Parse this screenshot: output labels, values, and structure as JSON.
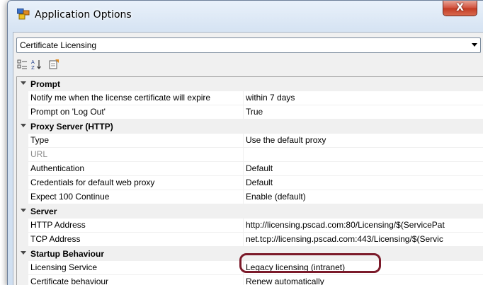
{
  "window": {
    "title": "Application Options",
    "close_label": "X"
  },
  "category": {
    "selected": "Certificate Licensing"
  },
  "toolbar": {
    "icons": [
      "categorized-icon",
      "sort-alphabetical-icon",
      "property-pages-icon"
    ]
  },
  "grid": {
    "rows": [
      {
        "type": "category",
        "label": "Prompt"
      },
      {
        "type": "property",
        "name": "Notify me when the license certificate will expire",
        "value": "within 7 days"
      },
      {
        "type": "property",
        "name": "Prompt on 'Log Out'",
        "value": "True"
      },
      {
        "type": "category",
        "label": "Proxy Server (HTTP)"
      },
      {
        "type": "property",
        "name": "Type",
        "value": "Use the default proxy"
      },
      {
        "type": "property",
        "name": "URL",
        "value": "",
        "disabled": true
      },
      {
        "type": "property",
        "name": "Authentication",
        "value": "Default"
      },
      {
        "type": "property",
        "name": "Credentials for default web proxy",
        "value": "Default"
      },
      {
        "type": "property",
        "name": "Expect 100 Continue",
        "value": "Enable (default)"
      },
      {
        "type": "category",
        "label": "Server"
      },
      {
        "type": "property",
        "name": "HTTP Address",
        "value": "http://licensing.pscad.com:80/Licensing/$(ServicePat"
      },
      {
        "type": "property",
        "name": "TCP Address",
        "value": "net.tcp://licensing.pscad.com:443/Licensing/$(Servic"
      },
      {
        "type": "category",
        "label": "Startup Behaviour"
      },
      {
        "type": "property",
        "name": "Licensing Service",
        "value": "Legacy licensing (intranet)"
      },
      {
        "type": "property",
        "name": "Certificate behaviour",
        "value": "Renew automatically"
      }
    ]
  },
  "colors": {
    "highlight_ring": "#7b1a2a",
    "category_background": "#f0f0f0",
    "disabled_text": "#8c8c8c"
  }
}
